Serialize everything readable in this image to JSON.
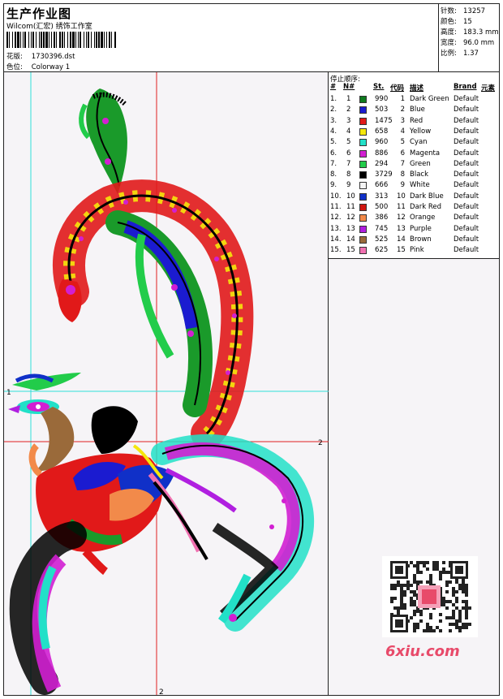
{
  "header": {
    "title": "生产作业图",
    "subtitle": "Wilcom(汇宏) 绣饰工作室",
    "design_label": "花版:",
    "design_value": "1730396.dst",
    "colorway_label": "色位:",
    "colorway_value": "Colorway 1"
  },
  "stats": [
    {
      "label": "针数:",
      "value": "13257"
    },
    {
      "label": "颜色:",
      "value": "15"
    },
    {
      "label": "高度:",
      "value": "183.3 mm"
    },
    {
      "label": "宽度:",
      "value": "96.0 mm"
    },
    {
      "label": "比例:",
      "value": "1.37"
    }
  ],
  "legend": {
    "title": "停止顺序:",
    "headers": {
      "idx": "#",
      "no": "N#",
      "st": "St.",
      "code": "代码",
      "desc": "描述",
      "brand": "Brand",
      "elem": "元素"
    },
    "rows": [
      {
        "idx": "1.",
        "no": "1",
        "st": "990",
        "code": "1",
        "desc": "Dark Green",
        "brand": "Default",
        "color": "#0f7a1e"
      },
      {
        "idx": "2.",
        "no": "2",
        "st": "503",
        "code": "2",
        "desc": "Blue",
        "brand": "Default",
        "color": "#1b1bd0"
      },
      {
        "idx": "3.",
        "no": "3",
        "st": "1475",
        "code": "3",
        "desc": "Red",
        "brand": "Default",
        "color": "#e11919"
      },
      {
        "idx": "4.",
        "no": "4",
        "st": "658",
        "code": "4",
        "desc": "Yellow",
        "brand": "Default",
        "color": "#f5e70c"
      },
      {
        "idx": "5.",
        "no": "5",
        "st": "960",
        "code": "5",
        "desc": "Cyan",
        "brand": "Default",
        "color": "#22e0c8"
      },
      {
        "idx": "6.",
        "no": "6",
        "st": "886",
        "code": "6",
        "desc": "Magenta",
        "brand": "Default",
        "color": "#d21fd2"
      },
      {
        "idx": "7.",
        "no": "7",
        "st": "294",
        "code": "7",
        "desc": "Green",
        "brand": "Default",
        "color": "#22cc4a"
      },
      {
        "idx": "8.",
        "no": "8",
        "st": "3729",
        "code": "8",
        "desc": "Black",
        "brand": "Default",
        "color": "#000000"
      },
      {
        "idx": "9.",
        "no": "9",
        "st": "666",
        "code": "9",
        "desc": "White",
        "brand": "Default",
        "color": "#f4f4f4"
      },
      {
        "idx": "10.",
        "no": "10",
        "st": "313",
        "code": "10",
        "desc": "Dark Blue",
        "brand": "Default",
        "color": "#1030c8"
      },
      {
        "idx": "11.",
        "no": "11",
        "st": "500",
        "code": "11",
        "desc": "Dark Red",
        "brand": "Default",
        "color": "#d0160f"
      },
      {
        "idx": "12.",
        "no": "12",
        "st": "386",
        "code": "12",
        "desc": "Orange",
        "brand": "Default",
        "color": "#f28a4a"
      },
      {
        "idx": "13.",
        "no": "13",
        "st": "745",
        "code": "13",
        "desc": "Purple",
        "brand": "Default",
        "color": "#b01fe0"
      },
      {
        "idx": "14.",
        "no": "14",
        "st": "525",
        "code": "14",
        "desc": "Brown",
        "brand": "Default",
        "color": "#9a6a3a"
      },
      {
        "idx": "15.",
        "no": "15",
        "st": "625",
        "code": "15",
        "desc": "Pink",
        "brand": "Default",
        "color": "#f070b0"
      }
    ]
  },
  "canvas": {
    "marker_1": "1",
    "marker_2": "2",
    "marker_2_bottom": "2"
  },
  "watermark": {
    "site": "6xiu.com"
  }
}
